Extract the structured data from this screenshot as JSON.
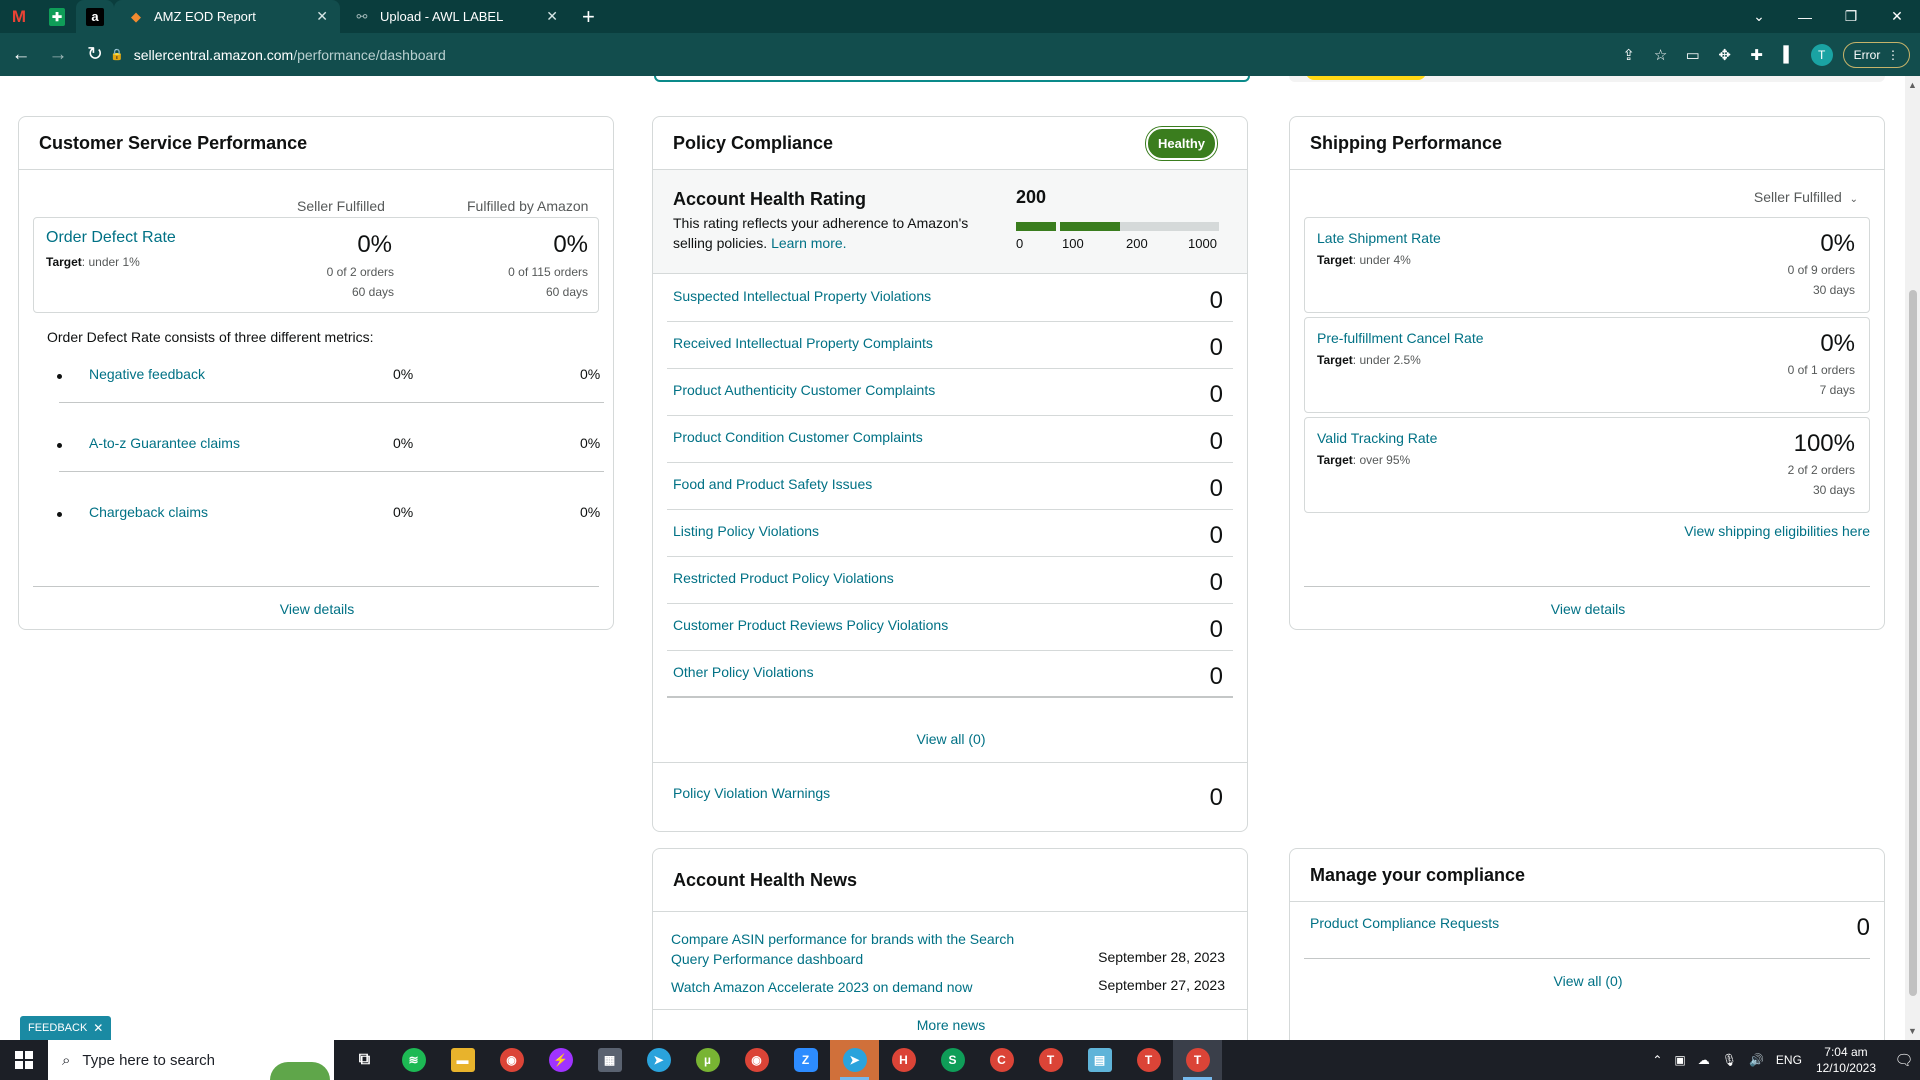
{
  "browser": {
    "pinned_tabs": [
      {
        "icon": "gmail-icon",
        "glyph": "M",
        "color": "#ea4335"
      },
      {
        "icon": "sheets-icon",
        "glyph": "✚",
        "color": "#ffffff",
        "bg": "#0f9d58"
      },
      {
        "icon": "amazon-icon",
        "glyph": "a",
        "color": "#ffffff",
        "bg": "#000000"
      }
    ],
    "tabs": [
      {
        "title": "AMZ EOD Report",
        "active": true
      },
      {
        "title": "Upload - AWL LABEL",
        "active": false
      }
    ],
    "new_tab": "+",
    "url_domain": "sellercentral.amazon.com",
    "url_path": "/performance/dashboard",
    "error_label": "Error"
  },
  "customer_service": {
    "title": "Customer Service Performance",
    "col_seller": "Seller Fulfilled",
    "col_fba": "Fulfilled by Amazon",
    "odr": {
      "label": "Order Defect Rate",
      "target_label": "Target",
      "target_value": ": under 1%",
      "seller": {
        "value": "0%",
        "orders": "0 of 2 orders",
        "period": "60 days"
      },
      "fba": {
        "value": "0%",
        "orders": "0 of 115 orders",
        "period": "60 days"
      }
    },
    "description": "Order Defect Rate consists of three different metrics:",
    "metrics": [
      {
        "label": "Negative feedback",
        "seller": "0%",
        "fba": "0%"
      },
      {
        "label": "A-to-z Guarantee claims",
        "seller": "0%",
        "fba": "0%"
      },
      {
        "label": "Chargeback claims",
        "seller": "0%",
        "fba": "0%"
      }
    ],
    "view_details": "View details"
  },
  "policy": {
    "title": "Policy Compliance",
    "status_badge": "Healthy",
    "ahr_title": "Account Health Rating",
    "ahr_text": "This rating reflects your adherence to Amazon's selling policies.",
    "learn_more": "Learn more.",
    "score": "200",
    "score_value": 200,
    "scale_max": 1000,
    "ticks": [
      "0",
      "100",
      "200",
      "1000"
    ],
    "violations": [
      {
        "label": "Suspected Intellectual Property Violations",
        "value": "0"
      },
      {
        "label": "Received Intellectual Property Complaints",
        "value": "0"
      },
      {
        "label": "Product Authenticity Customer Complaints",
        "value": "0"
      },
      {
        "label": "Product Condition Customer Complaints",
        "value": "0"
      },
      {
        "label": "Food and Product Safety Issues",
        "value": "0"
      },
      {
        "label": "Listing Policy Violations",
        "value": "0"
      },
      {
        "label": "Restricted Product Policy Violations",
        "value": "0"
      },
      {
        "label": "Customer Product Reviews Policy Violations",
        "value": "0"
      },
      {
        "label": "Other Policy Violations",
        "value": "0"
      }
    ],
    "view_all": "View all (0)",
    "warnings_label": "Policy Violation Warnings",
    "warnings_value": "0"
  },
  "shipping": {
    "title": "Shipping Performance",
    "selector": "Seller Fulfilled",
    "metrics": [
      {
        "label": "Late Shipment Rate",
        "target_label": "Target",
        "target_value": ": under 4%",
        "value": "0%",
        "orders": "0 of 9 orders",
        "period": "30 days"
      },
      {
        "label": "Pre-fulfillment Cancel Rate",
        "target_label": "Target",
        "target_value": ": under 2.5%",
        "value": "0%",
        "orders": "0 of 1 orders",
        "period": "7 days"
      },
      {
        "label": "Valid Tracking Rate",
        "target_label": "Target",
        "target_value": ": over 95%",
        "value": "100%",
        "orders": "2 of 2 orders",
        "period": "30 days"
      }
    ],
    "eligibilities_link": "View shipping eligibilities here",
    "view_details": "View details"
  },
  "news": {
    "title": "Account Health News",
    "items": [
      {
        "title": "Compare ASIN performance for brands with the Search Query Performance dashboard",
        "date": "September 28, 2023"
      },
      {
        "title": "Watch Amazon Accelerate 2023 on demand now",
        "date": "September 27, 2023"
      }
    ],
    "more": "More news"
  },
  "compliance": {
    "title": "Manage your compliance",
    "requests_label": "Product Compliance Requests",
    "requests_value": "0",
    "view_all": "View all (0)"
  },
  "feedback": {
    "label": "FEEDBACK",
    "close": "✕"
  },
  "taskbar": {
    "search_placeholder": "Type here to search",
    "apps": [
      {
        "name": "task-view-icon",
        "glyph": "⧉",
        "bg": "transparent"
      },
      {
        "name": "spotify-icon",
        "glyph": "≋",
        "bg": "#1db954"
      },
      {
        "name": "file-explorer-icon",
        "glyph": "▬",
        "bg": "#e8b32c"
      },
      {
        "name": "chrome-icon",
        "glyph": "◉",
        "bg": "#db4437"
      },
      {
        "name": "messenger-icon",
        "glyph": "⚡",
        "bg": "#a033ff"
      },
      {
        "name": "calculator-icon",
        "glyph": "▦",
        "bg": "#5a6270"
      },
      {
        "name": "telegram-icon",
        "glyph": "➤",
        "bg": "#2aa3dc"
      },
      {
        "name": "utorrent-icon",
        "glyph": "µ",
        "bg": "#78b433"
      },
      {
        "name": "chrome-profile-icon",
        "glyph": "◉",
        "bg": "#db4437"
      },
      {
        "name": "zoom-icon",
        "glyph": "Z",
        "bg": "#2d8cff"
      },
      {
        "name": "telegram-badge-icon",
        "glyph": "➤",
        "bg": "#2aa3dc",
        "active": true
      },
      {
        "name": "chrome-h-icon",
        "glyph": "H",
        "bg": "#db4437"
      },
      {
        "name": "chrome-s-icon",
        "glyph": "S",
        "bg": "#0f9d58"
      },
      {
        "name": "chrome-c-icon",
        "glyph": "C",
        "bg": "#db4437"
      },
      {
        "name": "chrome-t-icon",
        "glyph": "T",
        "bg": "#db4437"
      },
      {
        "name": "notepad-icon",
        "glyph": "▤",
        "bg": "#5fb4d9"
      },
      {
        "name": "chrome-t2-icon",
        "glyph": "T",
        "bg": "#db4437"
      },
      {
        "name": "chrome-active-icon",
        "glyph": "T",
        "bg": "#db4437",
        "active": true
      }
    ],
    "language": "ENG",
    "time": "7:04 am",
    "date": "12/10/2023"
  }
}
